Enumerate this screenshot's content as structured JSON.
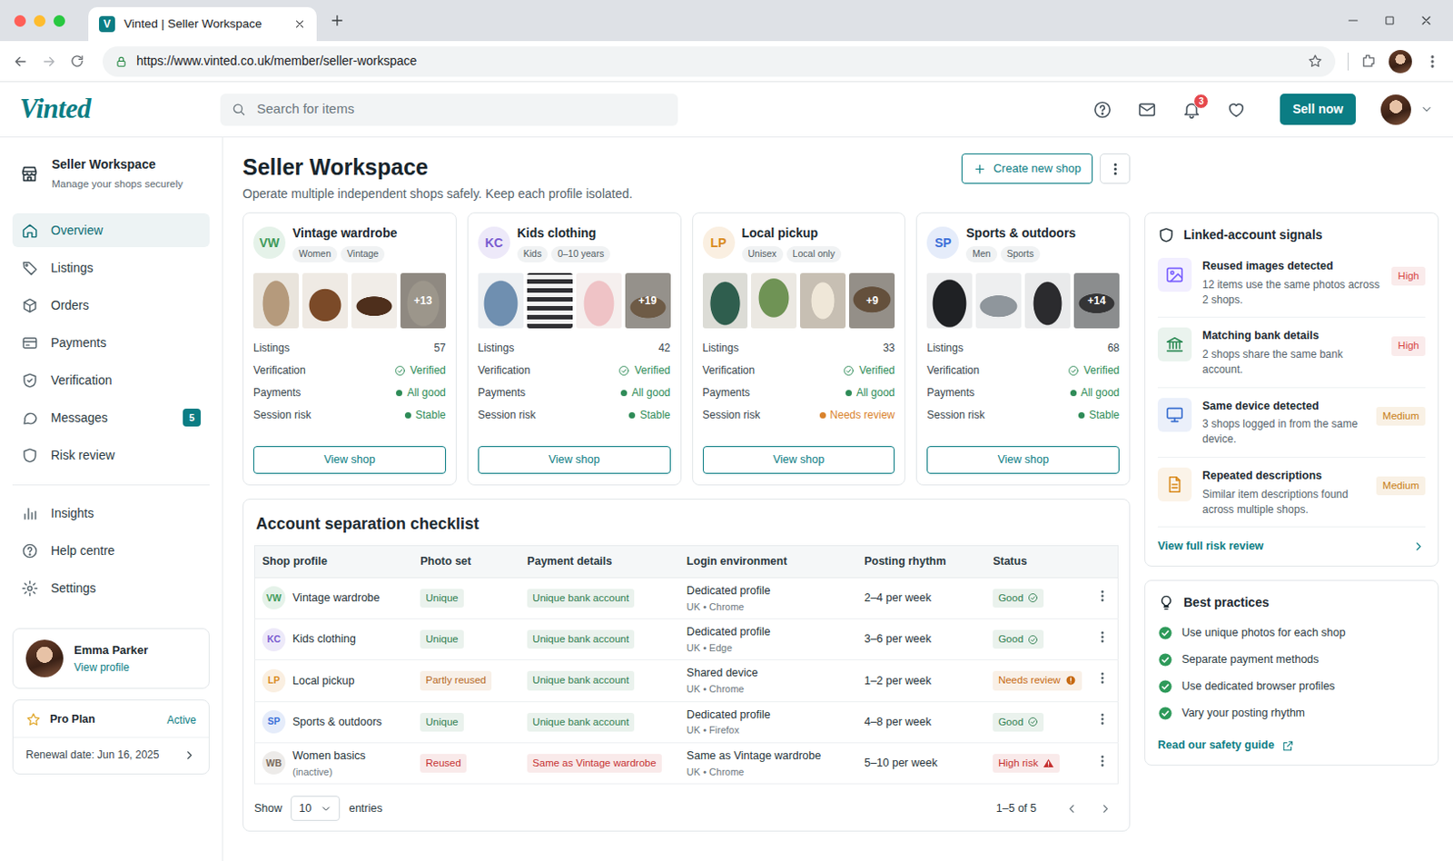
{
  "browser": {
    "favicon": "V",
    "tab_title": "Vinted | Seller Workspace",
    "url": "https://www.vinted.co.uk/member/seller-workspace"
  },
  "header": {
    "logo": "Vinted",
    "search_placeholder": "Search for items",
    "notification_count": "3",
    "sell_button": "Sell now"
  },
  "sidebar": {
    "title": "Seller Workspace",
    "subtitle": "Manage your shops securely",
    "items": [
      {
        "label": "Overview",
        "selected": true
      },
      {
        "label": "Listings",
        "selected": false
      },
      {
        "label": "Orders",
        "selected": false
      },
      {
        "label": "Payments",
        "selected": false
      },
      {
        "label": "Verification",
        "selected": false
      },
      {
        "label": "Messages",
        "selected": false,
        "badge": "5"
      },
      {
        "label": "Risk review",
        "selected": false
      }
    ],
    "secondary_items": [
      {
        "label": "Insights",
        "selected": false
      },
      {
        "label": "Help centre",
        "selected": false
      },
      {
        "label": "Settings",
        "selected": false
      }
    ],
    "profile": {
      "name": "Emma Parker",
      "link": "View profile"
    },
    "plan": {
      "name": "Pro Plan",
      "status": "Active",
      "renewal": "Renewal date: Jun 16, 2025"
    }
  },
  "page": {
    "title": "Seller Workspace",
    "subtitle": "Operate multiple independent shops safely. Keep each profile isolated.",
    "create_button": "Create new shop"
  },
  "shops": [
    {
      "initials": "VW",
      "name": "Vintage wardrobe",
      "color": "#3f9a5a",
      "tags": [
        "Women",
        "Vintage"
      ],
      "more_photos": "+13",
      "stats": [
        {
          "label": "Listings",
          "value": "57",
          "kind": "count"
        },
        {
          "label": "Verification",
          "value": "Verified",
          "kind": "check",
          "color": "#2e8b57"
        },
        {
          "label": "Payments",
          "value": "All good",
          "kind": "dot",
          "color": "#2e8b57"
        },
        {
          "label": "Session risk",
          "value": "Stable",
          "kind": "dot",
          "color": "#2e8b57"
        }
      ],
      "button": "View shop"
    },
    {
      "initials": "KC",
      "name": "Kids clothing",
      "color": "#7a5bd0",
      "tags": [
        "Kids",
        "0–10 years"
      ],
      "more_photos": "+19",
      "stats": [
        {
          "label": "Listings",
          "value": "42",
          "kind": "count"
        },
        {
          "label": "Verification",
          "value": "Verified",
          "kind": "check",
          "color": "#2e8b57"
        },
        {
          "label": "Payments",
          "value": "All good",
          "kind": "dot",
          "color": "#2e8b57"
        },
        {
          "label": "Session risk",
          "value": "Stable",
          "kind": "dot",
          "color": "#2e8b57"
        }
      ],
      "button": "View shop"
    },
    {
      "initials": "LP",
      "name": "Local pickup",
      "color": "#d98a1c",
      "tags": [
        "Unisex",
        "Local only"
      ],
      "more_photos": "+9",
      "stats": [
        {
          "label": "Listings",
          "value": "33",
          "kind": "count"
        },
        {
          "label": "Verification",
          "value": "Verified",
          "kind": "check",
          "color": "#2e8b57"
        },
        {
          "label": "Payments",
          "value": "All good",
          "kind": "dot",
          "color": "#2e8b57"
        },
        {
          "label": "Session risk",
          "value": "Needs review",
          "kind": "dot",
          "color": "#d9822b"
        }
      ],
      "button": "View shop"
    },
    {
      "initials": "SP",
      "name": "Sports & outdoors",
      "color": "#3b6fd8",
      "tags": [
        "Men",
        "Sports"
      ],
      "more_photos": "+14",
      "stats": [
        {
          "label": "Listings",
          "value": "68",
          "kind": "count"
        },
        {
          "label": "Verification",
          "value": "Verified",
          "kind": "check",
          "color": "#2e8b57"
        },
        {
          "label": "Payments",
          "value": "All good",
          "kind": "dot",
          "color": "#2e8b57"
        },
        {
          "label": "Session risk",
          "value": "Stable",
          "kind": "dot",
          "color": "#2e8b57"
        }
      ],
      "button": "View shop"
    }
  ],
  "checklist": {
    "title": "Account separation checklist",
    "columns": [
      "Shop profile",
      "Photo set",
      "Payment details",
      "Login environment",
      "Posting rhythm",
      "Status"
    ],
    "rows": [
      {
        "initials": "VW",
        "color": "#3f9a5a",
        "name": "Vintage wardrobe",
        "photo_set": {
          "text": "Unique",
          "color": "#2e7d4f"
        },
        "payment": {
          "text": "Unique bank account",
          "color": "#2e7d4f"
        },
        "login": {
          "main": "Dedicated profile",
          "sub": "UK • Chrome"
        },
        "rhythm": "2–4 per week",
        "status": {
          "text": "Good",
          "kind": "good",
          "color": "#2e7d4f"
        }
      },
      {
        "initials": "KC",
        "color": "#7a5bd0",
        "name": "Kids clothing",
        "photo_set": {
          "text": "Unique",
          "color": "#2e7d4f"
        },
        "payment": {
          "text": "Unique bank account",
          "color": "#2e7d4f"
        },
        "login": {
          "main": "Dedicated profile",
          "sub": "UK • Edge"
        },
        "rhythm": "3–6 per week",
        "status": {
          "text": "Good",
          "kind": "good",
          "color": "#2e7d4f"
        }
      },
      {
        "initials": "LP",
        "color": "#d98a1c",
        "name": "Local pickup",
        "photo_set": {
          "text": "Partly reused",
          "color": "#b7691f"
        },
        "payment": {
          "text": "Unique bank account",
          "color": "#2e7d4f"
        },
        "login": {
          "main": "Shared device",
          "sub": "UK • Chrome"
        },
        "rhythm": "1–2 per week",
        "status": {
          "text": "Needs review",
          "kind": "review",
          "color": "#c76a12"
        }
      },
      {
        "initials": "SP",
        "color": "#3b6fd8",
        "name": "Sports & outdoors",
        "photo_set": {
          "text": "Unique",
          "color": "#2e7d4f"
        },
        "payment": {
          "text": "Unique bank account",
          "color": "#2e7d4f"
        },
        "login": {
          "main": "Dedicated profile",
          "sub": "UK • Firefox"
        },
        "rhythm": "4–8 per week",
        "status": {
          "text": "Good",
          "kind": "good",
          "color": "#2e7d4f"
        }
      },
      {
        "initials": "WB",
        "color": "#7a6a5a",
        "name": "Women basics",
        "note": "(inactive)",
        "photo_set": {
          "text": "Reused",
          "color": "#c53030"
        },
        "payment": {
          "text": "Same as Vintage wardrobe",
          "color": "#c53030"
        },
        "login": {
          "main": "Same as Vintage wardrobe",
          "sub": "UK • Chrome"
        },
        "rhythm": "5–10 per week",
        "status": {
          "text": "High risk",
          "kind": "high",
          "color": "#c53030"
        }
      }
    ],
    "footer": {
      "show": "Show",
      "page_size": "10",
      "entries": "entries",
      "range": "1–5 of 5"
    }
  },
  "signals": {
    "title": "Linked-account signals",
    "items": [
      {
        "title": "Reused images detected",
        "description": "12 items use the same photos across 2 shops.",
        "severity": "High",
        "severity_color": "#d64545",
        "color": "#7b61ff"
      },
      {
        "title": "Matching bank details",
        "description": "2 shops share the same bank account.",
        "severity": "High",
        "severity_color": "#d64545",
        "color": "#2e8b57"
      },
      {
        "title": "Same device detected",
        "description": "3 shops logged in from the same device.",
        "severity": "Medium",
        "severity_color": "#c77c12",
        "color": "#3a6fd0"
      },
      {
        "title": "Repeated descriptions",
        "description": "Similar item descriptions found across multiple shops.",
        "severity": "Medium",
        "severity_color": "#c77c12",
        "color": "#d98a1c"
      }
    ],
    "link": "View full risk review"
  },
  "best_practices": {
    "title": "Best practices",
    "items": [
      "Use unique photos for each shop",
      "Separate payment methods",
      "Use dedicated browser profiles",
      "Vary your posting rhythm"
    ],
    "link": "Read our safety guide"
  }
}
